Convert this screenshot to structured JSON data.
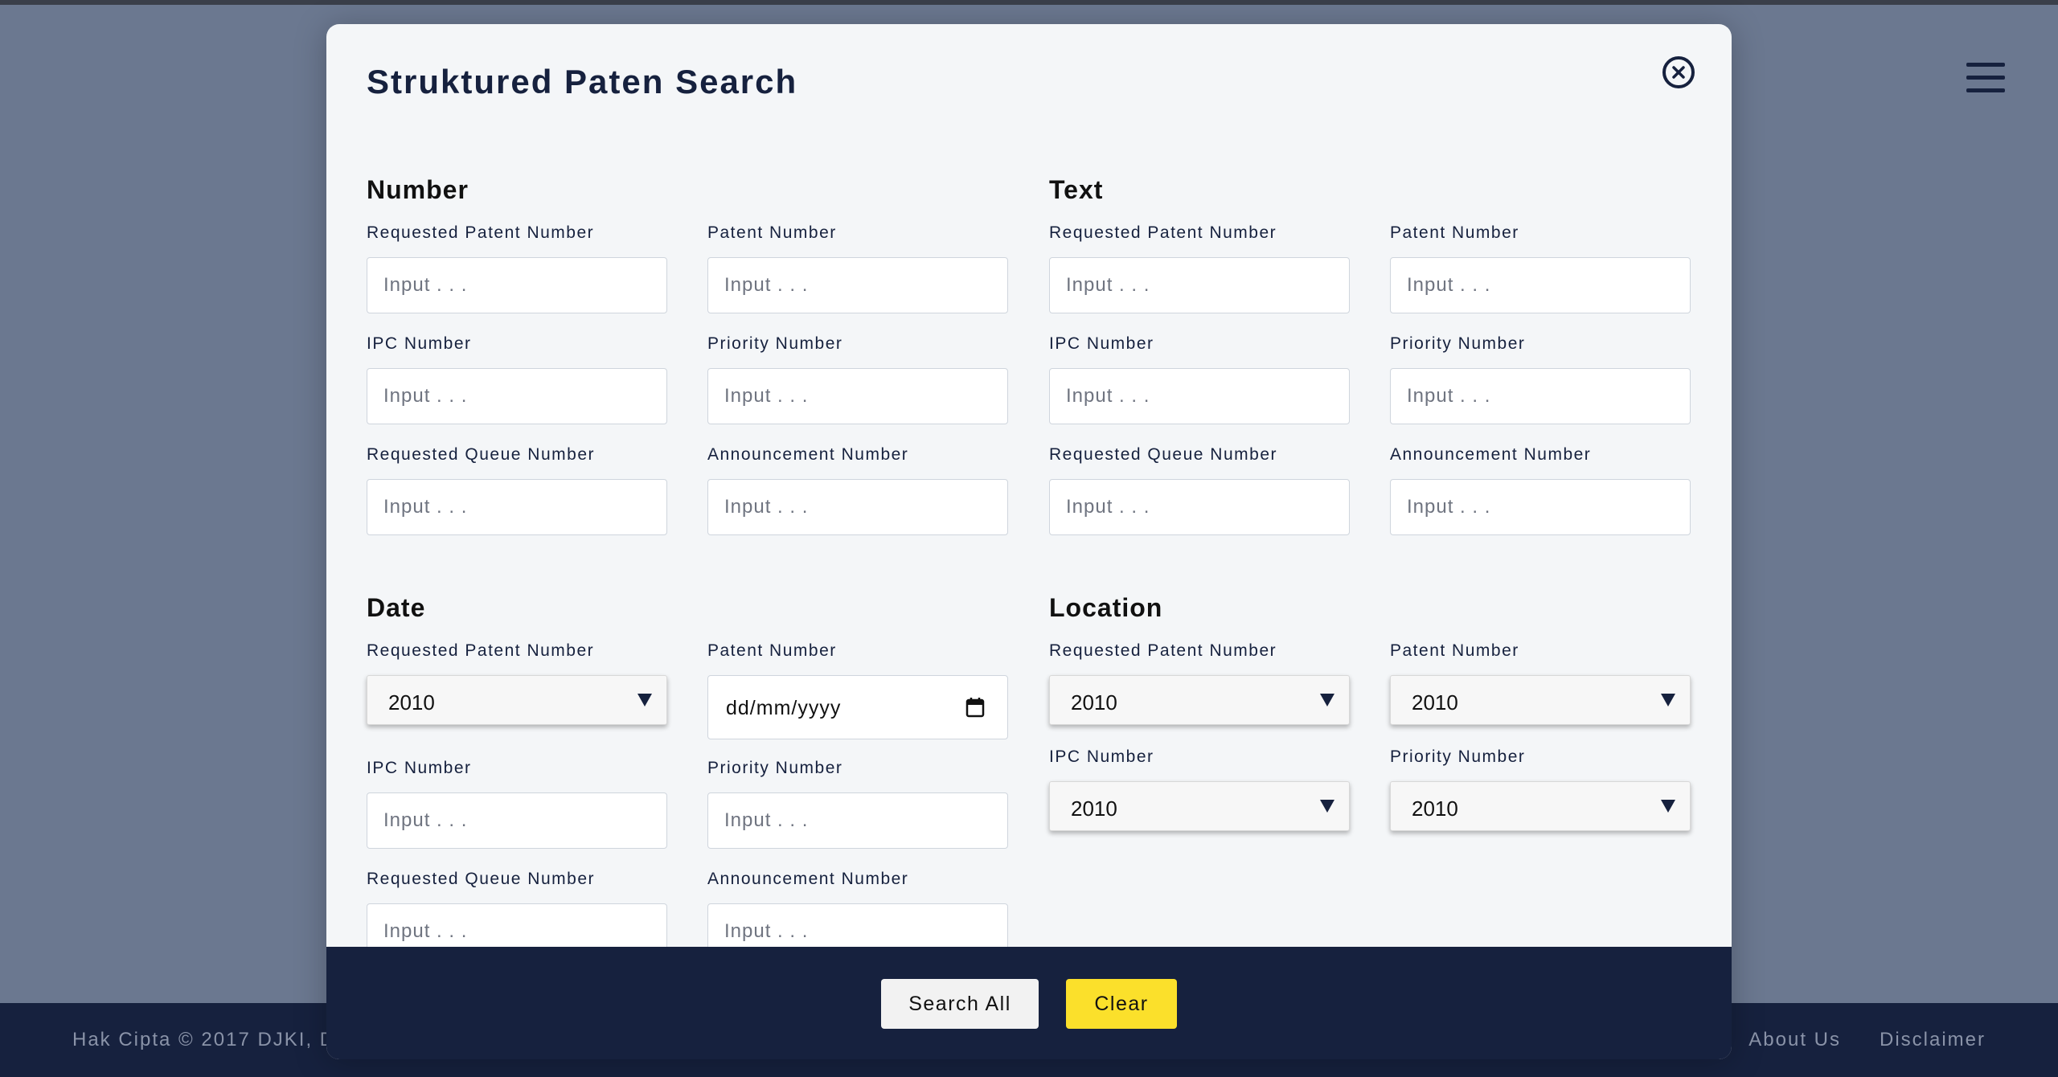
{
  "modal": {
    "title": "Struktured Paten Search",
    "close_icon": "close-circle-icon"
  },
  "sections": {
    "number": {
      "title": "Number",
      "fields": [
        {
          "label": "Requested Patent Number",
          "placeholder": "Input . . .",
          "value": ""
        },
        {
          "label": "Patent Number",
          "placeholder": "Input . . .",
          "value": ""
        },
        {
          "label": "IPC Number",
          "placeholder": "Input . . .",
          "value": ""
        },
        {
          "label": "Priority Number",
          "placeholder": "Input . . .",
          "value": ""
        },
        {
          "label": "Requested Queue Number",
          "placeholder": "Input . . .",
          "value": ""
        },
        {
          "label": "Announcement Number",
          "placeholder": "Input . . .",
          "value": ""
        }
      ]
    },
    "text": {
      "title": "Text",
      "fields": [
        {
          "label": "Requested Patent Number",
          "placeholder": "Input . . .",
          "value": ""
        },
        {
          "label": "Patent Number",
          "placeholder": "Input . . .",
          "value": ""
        },
        {
          "label": "IPC Number",
          "placeholder": "Input . . .",
          "value": ""
        },
        {
          "label": "Priority Number",
          "placeholder": "Input . . .",
          "value": ""
        },
        {
          "label": "Requested Queue Number",
          "placeholder": "Input . . .",
          "value": ""
        },
        {
          "label": "Announcement Number",
          "placeholder": "Input . . .",
          "value": ""
        }
      ]
    },
    "date": {
      "title": "Date",
      "fields": [
        {
          "label": "Requested Patent Number",
          "type": "select",
          "selected": "2010"
        },
        {
          "label": "Patent Number",
          "type": "date",
          "value": "dd/mm/yyyy"
        },
        {
          "label": "IPC Number",
          "placeholder": "Input . . .",
          "value": ""
        },
        {
          "label": "Priority Number",
          "placeholder": "Input . . .",
          "value": ""
        },
        {
          "label": "Requested Queue Number",
          "placeholder": "Input . . .",
          "value": ""
        },
        {
          "label": "Announcement Number",
          "placeholder": "Input . . .",
          "value": ""
        }
      ]
    },
    "location": {
      "title": "Location",
      "fields": [
        {
          "label": "Requested Patent Number",
          "type": "select",
          "selected": "2010"
        },
        {
          "label": "Patent Number",
          "type": "select",
          "selected": "2010"
        },
        {
          "label": "IPC Number",
          "type": "select",
          "selected": "2010"
        },
        {
          "label": "Priority Number",
          "type": "select",
          "selected": "2010"
        }
      ]
    }
  },
  "actions": {
    "search_all": "Search All",
    "clear": "Clear"
  },
  "footer": {
    "copyright": "Hak Cipta © 2017 DJKI, D",
    "links": [
      "About Us",
      "Disclaimer"
    ]
  },
  "header": {
    "menu_icon": "hamburger-menu-icon"
  },
  "colors": {
    "navy": "#16213e",
    "clear_button": "#fbe02b",
    "modal_bg": "#f4f6f8",
    "backdrop": "#6b7890"
  }
}
